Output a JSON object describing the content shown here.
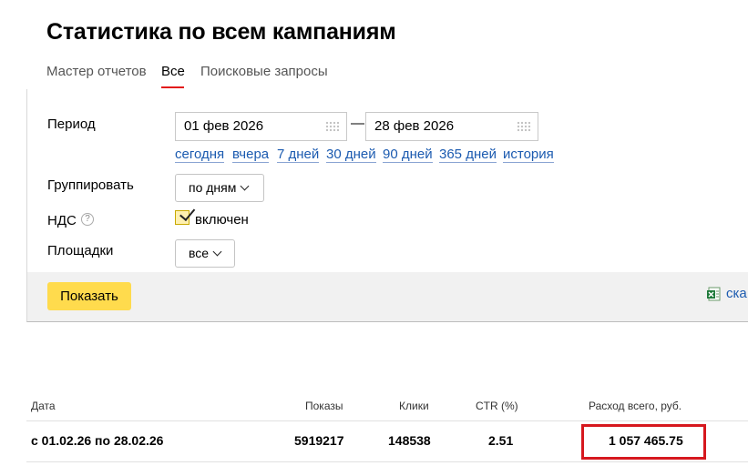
{
  "page": {
    "title": "Статистика по всем кампаниям"
  },
  "tabs": [
    {
      "label": "Мастер отчетов",
      "active": false
    },
    {
      "label": "Все",
      "active": true
    },
    {
      "label": "Поисковые запросы",
      "active": false
    }
  ],
  "form": {
    "period_label": "Период",
    "date_from": "01 фев 2026",
    "date_to": "28 фев 2026",
    "separator": "—",
    "quick_periods": [
      "сегодня",
      "вчера",
      "7 дней",
      "30 дней",
      "90 дней",
      "365 дней",
      "история"
    ],
    "group_label": "Группировать",
    "group_value": "по дням",
    "vat_label": "НДС",
    "vat_help": "?",
    "vat_checked": true,
    "vat_value_label": "включен",
    "platforms_label": "Площадки",
    "platforms_value": "все",
    "show_button": "Показать",
    "download_label": "ска"
  },
  "table": {
    "headers": [
      "Дата",
      "Показы",
      "Клики",
      "CTR (%)",
      "Расход всего, руб."
    ],
    "rows": [
      [
        "с 01.02.26 по 28.02.26",
        "5919217",
        "148538",
        "2.51",
        "1 057 465.75"
      ]
    ]
  },
  "colors": {
    "accent_tab": "#e21b1b",
    "button_yellow": "#ffdb4d",
    "link_blue": "#1c5bb0",
    "highlight_red": "#d6181e"
  },
  "icons": {
    "calendar": "calendar-icon",
    "help": "help-icon",
    "excel": "excel-icon",
    "chevron": "chevron-down-icon"
  }
}
